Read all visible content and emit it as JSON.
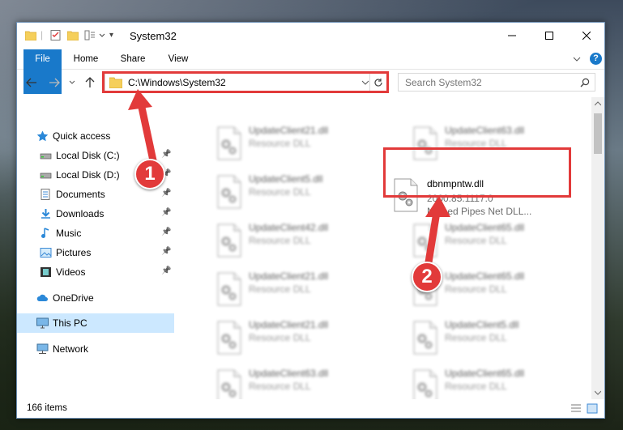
{
  "window": {
    "title": "System32"
  },
  "ribbon": {
    "tabs": [
      "File",
      "Home",
      "Share",
      "View"
    ]
  },
  "address": {
    "path": "C:\\Windows\\System32"
  },
  "search": {
    "placeholder": "Search System32"
  },
  "sidebar": {
    "items": [
      {
        "label": "Quick access",
        "icon": "star-icon",
        "pinned": false
      },
      {
        "label": "Local Disk (C:)",
        "icon": "drive-icon",
        "pinned": true
      },
      {
        "label": "Local Disk (D:)",
        "icon": "drive-icon",
        "pinned": true
      },
      {
        "label": "Documents",
        "icon": "documents-icon",
        "pinned": true
      },
      {
        "label": "Downloads",
        "icon": "downloads-icon",
        "pinned": true
      },
      {
        "label": "Music",
        "icon": "music-icon",
        "pinned": true
      },
      {
        "label": "Pictures",
        "icon": "pictures-icon",
        "pinned": true
      },
      {
        "label": "Videos",
        "icon": "videos-icon",
        "pinned": true
      },
      {
        "label": "OneDrive",
        "icon": "cloud-icon",
        "pinned": false
      },
      {
        "label": "This PC",
        "icon": "computer-icon",
        "pinned": false,
        "selected": true
      },
      {
        "label": "Network",
        "icon": "network-icon",
        "pinned": false
      }
    ]
  },
  "files": [
    {
      "name": "UpdateClient21.dll",
      "type": "Resource DLL"
    },
    {
      "name": "UpdateClient63.dll",
      "type": "Resource DLL"
    },
    {
      "name": "UpdateClient5.dll",
      "type": "Resource DLL"
    },
    {
      "name": "dbnmpntw.dll",
      "version": "2000.85.1117.0",
      "description": "Named Pipes Net DLL...",
      "highlighted": true
    },
    {
      "name": "UpdateClient42.dll",
      "type": "Resource DLL"
    },
    {
      "name": "UpdateClient65.dll",
      "type": "Resource DLL"
    },
    {
      "name": "UpdateClient21.dll",
      "type": "Resource DLL"
    },
    {
      "name": "UpdateClient65.dll",
      "type": "Resource DLL"
    },
    {
      "name": "UpdateClient21.dll",
      "type": "Resource DLL"
    },
    {
      "name": "UpdateClient5.dll",
      "type": "Resource DLL"
    },
    {
      "name": "UpdateClient63.dll",
      "type": "Resource DLL"
    },
    {
      "name": "UpdateClient65.dll",
      "type": "Resource DLL"
    }
  ],
  "status": {
    "item_count": "166 items"
  },
  "callouts": [
    "1",
    "2"
  ],
  "colors": {
    "accent": "#1979ca",
    "highlight": "#e23a3a",
    "selected": "#cce8ff"
  }
}
